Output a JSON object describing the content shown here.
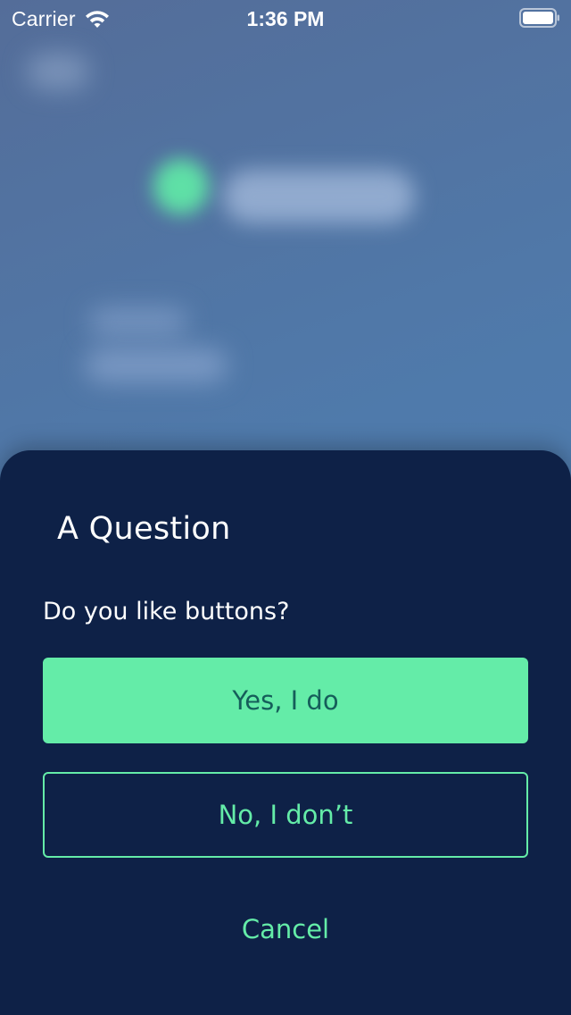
{
  "status_bar": {
    "carrier": "Carrier",
    "time": "1:36 PM",
    "wifi_icon": "wifi-icon",
    "battery_icon": "battery-full-icon"
  },
  "dialog": {
    "title": "A Question",
    "message": "Do you like buttons?",
    "primary_label": "Yes, I do",
    "secondary_label": "No, I don’t",
    "cancel_label": "Cancel"
  },
  "colors": {
    "sheet_background": "#0e2147",
    "accent": "#64eca8",
    "primary_text": "#155e5a",
    "background_blur": "#4f7aab"
  }
}
